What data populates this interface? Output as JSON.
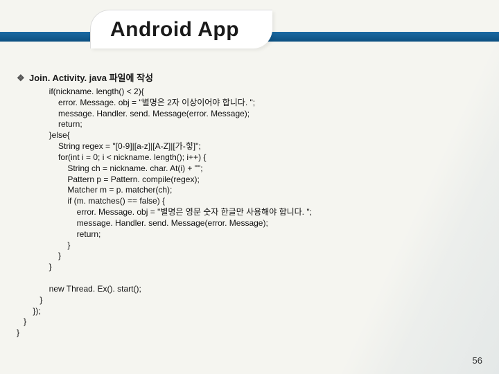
{
  "slide": {
    "title": "Android App",
    "bullet_label": "Join. Activity. java 파일에 작성",
    "code_text": "              if(nickname. length() < 2){\n                  error. Message. obj = \"별명은 2자 이상이어야 합니다. \";\n                  message. Handler. send. Message(error. Message);\n                  return;\n              }else{\n                  String regex = \"[0-9]|[a-z]|[A-Z]|[가-힣]\";\n                  for(int i = 0; i < nickname. length(); i++) {\n                      String ch = nickname. char. At(i) + \"\";\n                      Pattern p = Pattern. compile(regex);\n                      Matcher m = p. matcher(ch);\n                      if (m. matches() == false) {\n                          error. Message. obj = \"별명은 영문 숫자 한글만 사용해야 합니다. \";\n                          message. Handler. send. Message(error. Message);\n                          return;\n                      }\n                  }\n              }\n\n              new Thread. Ex(). start();\n          }\n       });\n   }\n}",
    "page_number": "56",
    "bullet_glyph": "❖"
  }
}
